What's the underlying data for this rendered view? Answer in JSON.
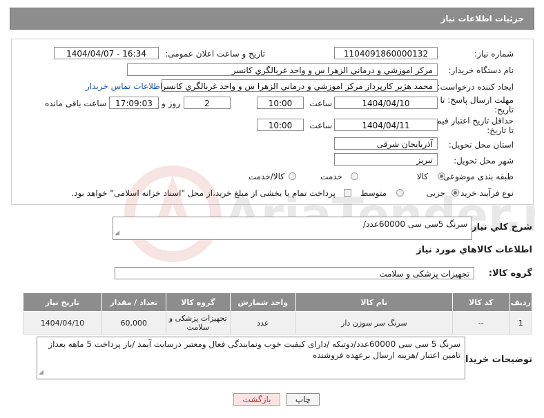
{
  "header": {
    "title": "جزئیات اطلاعات نیاز"
  },
  "form": {
    "need_number_label": "شماره نیاز:",
    "need_number": "1104091860000132",
    "announce_label": "تاریخ و ساعت اعلان عمومی:",
    "announce_value": "1404/04/07 - 16:34",
    "buyer_org_label": "نام دستگاه خریدار:",
    "buyer_org": "مرکز اموزشي و درماني الزهرا س  و واحد غربالگري کانسر",
    "requester_label": "ایجاد کننده درخواست:",
    "requester": "محمد هژیر کارپرداز مرکز اموزشي و درماني الزهرا س  و واحد غربالگري کانسر",
    "contact_link": "اطلاعات تماس خریدار",
    "deadline_label_1": "مهلت ارسال پاسخ: تا",
    "deadline_label_2": "تاریخ:",
    "deadline_date": "1404/04/10",
    "time_label": "ساعت",
    "deadline_time": "10:00",
    "days_value": "2",
    "days_label": "روز و",
    "remaining_time": "17:09:03",
    "remaining_label": "ساعت باقی مانده",
    "validity_label_1": "حداقل تاریخ اعتبار قیمت:",
    "validity_label_2": "تا تاریخ:",
    "validity_date": "1404/04/11",
    "validity_time": "10:00",
    "province_label": "استان محل تحویل:",
    "province": "آذربایجان شرقی",
    "city_label": "شهر محل تحویل:",
    "city": "تبریز",
    "category_label": "طبقه بندی موضوعی:",
    "category_options": [
      "کالا",
      "خدمت",
      "کالا/خدمت"
    ],
    "process_label": "نوع فرآیند خرید :",
    "process_options": [
      "جزیی",
      "متوسط"
    ],
    "payment_note": "پرداخت تمام یا بخشی از مبلغ خرید،از محل \"اسناد خزانه اسلامی\" خواهد بود."
  },
  "summary": {
    "label": "شرح کلي نياز:",
    "value": "سرنگ 5سی سی 60000عدد/"
  },
  "goods_section_title": "اطلاعات کالاهاي مورد نياز",
  "goods_group": {
    "label": "گروه کالا:",
    "value": "تجهیزات پزشکی و سلامت"
  },
  "table": {
    "headers": [
      "ردیف",
      "کد کالا",
      "نام کالا",
      "واحد شمارش",
      "گروه کالا",
      "تعداد / مقدار",
      "تاریخ نیاز"
    ],
    "rows": [
      [
        "1",
        "--",
        "سرنگ سر سوزن دار",
        "عدد",
        "تجهیزات پزشکی و سلامت",
        "60,000",
        "1404/04/10"
      ]
    ]
  },
  "buyer_notes": {
    "label": "توضیحات خریدار:",
    "value": "سرنگ 5 سی سی 60000عدد/دوتیکه /دارای کیفیت خوب ونمایندگی فعال ومعتبر درسایت آیمد /باز پرداخت 5 ماهه بعداز تامین اعتبار /هزینه ارسال برعهده فروشنده"
  },
  "buttons": {
    "print": "چاپ",
    "back": "بازگشت"
  },
  "watermark_text": "AriaTender.neT",
  "colors": {
    "header_bg": "#8d8d8d",
    "link": "#1a56b0",
    "back_button": "#c0392b"
  }
}
